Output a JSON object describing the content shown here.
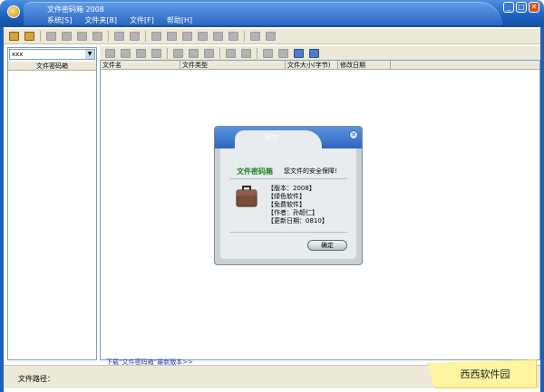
{
  "window": {
    "title": "文件密码箱 2008",
    "menu": [
      "系统[S]",
      "文件夹[B]",
      "文件[F]",
      "帮助[H]"
    ],
    "min": "_",
    "max": "□",
    "close": "✕"
  },
  "left_panel": {
    "drive": "xxx",
    "tree_header": "文件密码箱"
  },
  "file_list": {
    "columns": [
      "文件名",
      "文件类型",
      "文件大小(字节)",
      "修改日期"
    ]
  },
  "footer": {
    "download_link": "下载“文件密码箱”最新版本>>",
    "path_label": "文件路径：",
    "watermark": "西西软件园"
  },
  "about": {
    "title": "关于",
    "app_name": "文件密码箱",
    "slogan": "您文件的安全保障!",
    "info": [
      "【版本：2008】",
      "【绿色软件】",
      "【免费软件】",
      "【作者：孙超仁】",
      "【更新日期：0810】"
    ],
    "ok": "确定",
    "close": "✕"
  },
  "icons": {
    "toolbar1": [
      "folder-open-icon",
      "folder-lock-icon",
      "file-icon",
      "copy-icon",
      "cut-icon",
      "arrow-right-icon",
      "page-icon",
      "pages-icon",
      "box-icon",
      "box-open-icon",
      "folder-icon",
      "folder-up-icon",
      "folder-move-icon",
      "folder-copy-icon",
      "stop-icon",
      "square-icon"
    ],
    "toolbar2": [
      "play-icon",
      "next-icon",
      "page-icon",
      "move-icon",
      "cut-icon",
      "copy-icon",
      "paste-icon",
      "move-left-icon",
      "move-right-icon",
      "mail-icon",
      "edit-icon",
      "help-icon",
      "info-icon"
    ]
  }
}
